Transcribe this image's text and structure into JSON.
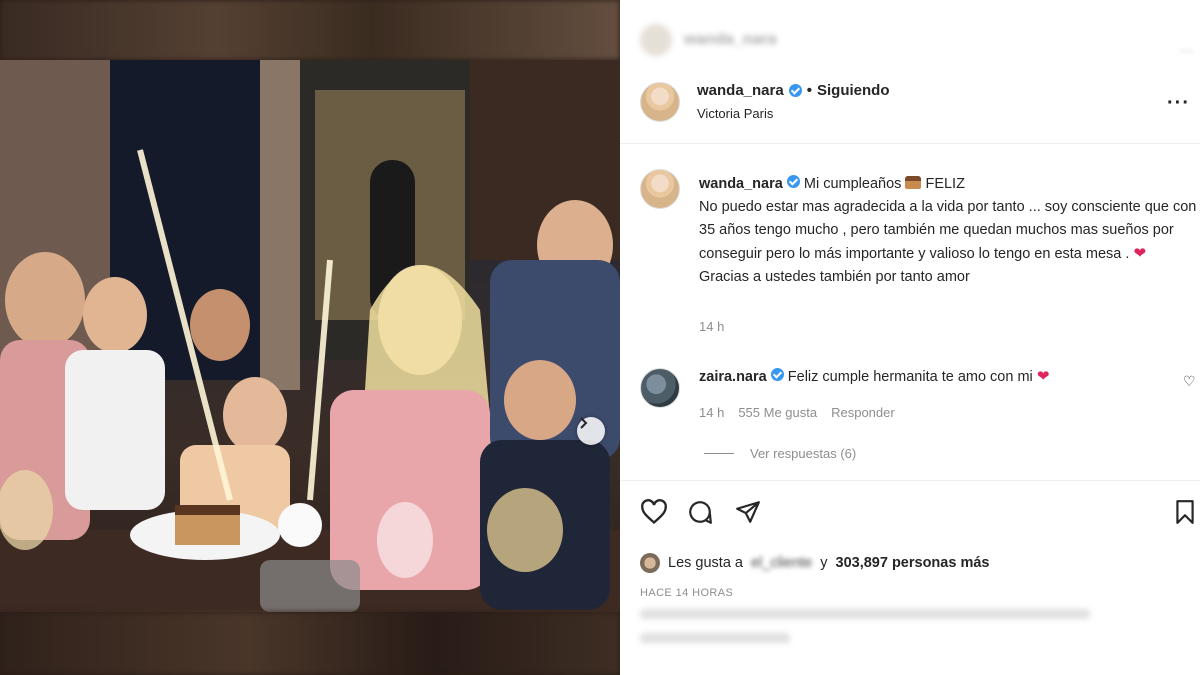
{
  "post": {
    "author": "wanda_nara",
    "follow_state": "Siguiendo",
    "separator": "•",
    "location": "Victoria Paris"
  },
  "caption": {
    "author": "wanda_nara",
    "part1": "Mi cumpleaños",
    "part2": "FELIZ",
    "body1": "No puedo estar mas agradecida a la vida por tanto ... soy consciente que con 35 años tengo mucho , pero también me quedan muchos mas sueños por conseguir pero lo más importante y valioso lo tengo en esta mesa .",
    "body2": "Gracias a ustedes también por tanto amor",
    "time": "14 h",
    "icons": [
      "cake-icon",
      "heart-icon"
    ]
  },
  "reply": {
    "author": "zaira.nara",
    "text": "Feliz cumple hermanita te amo con mi",
    "time": "14 h",
    "likes": "555 Me gusta",
    "reply_label": "Responder",
    "view_replies": "Ver respuestas (6)"
  },
  "engagement": {
    "likes_prefix": "Les gusta a",
    "likes_blurred_name": "el_cliente",
    "likes_suffix_and": "y",
    "likes_count_text": "303,897 personas más",
    "time_ago": "HACE 14 HORAS"
  },
  "icons": {
    "more": "more-options-icon",
    "like": "heart-icon",
    "comment": "comment-icon",
    "share": "share-icon",
    "save": "bookmark-icon",
    "next": "chevron-right-icon"
  },
  "colors": {
    "verified": "#3897f0",
    "heart": "#e0245e",
    "muted": "#8e8e8e",
    "text": "#262626"
  }
}
